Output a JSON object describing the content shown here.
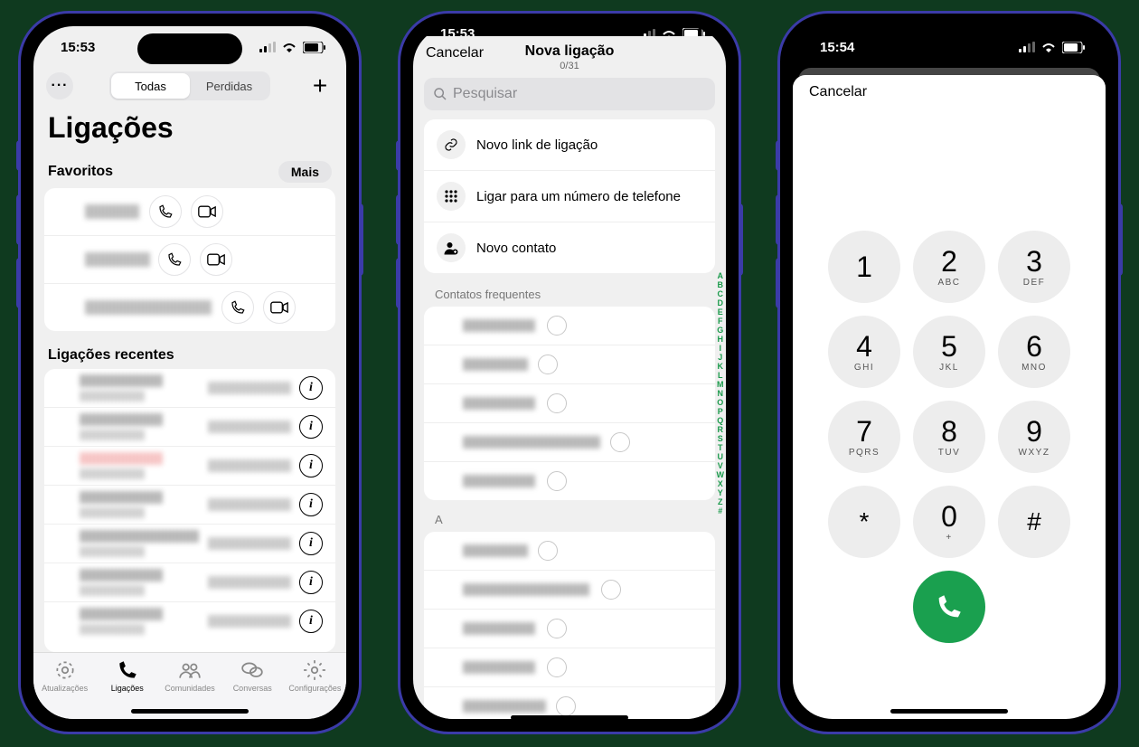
{
  "status": {
    "time1": "15:53",
    "time2": "15:53",
    "time3": "15:54"
  },
  "p1": {
    "seg_all": "Todas",
    "seg_missed": "Perdidas",
    "title": "Ligações",
    "fav_hdr": "Favoritos",
    "fav_more": "Mais",
    "recent_hdr": "Ligações recentes",
    "tabs": {
      "updates": "Atualizações",
      "calls": "Ligações",
      "communities": "Comunidades",
      "chats": "Conversas",
      "settings": "Configurações"
    }
  },
  "p2": {
    "cancel": "Cancelar",
    "title": "Nova ligação",
    "subtitle": "0/31",
    "search_placeholder": "Pesquisar",
    "opt_link": "Novo link de ligação",
    "opt_dial": "Ligar para um número de telefone",
    "opt_new_contact": "Novo contato",
    "freq_hdr": "Contatos frequentes",
    "alpha_hdr": "A",
    "index": [
      "A",
      "B",
      "C",
      "D",
      "E",
      "F",
      "G",
      "H",
      "I",
      "J",
      "K",
      "L",
      "M",
      "N",
      "O",
      "P",
      "Q",
      "R",
      "S",
      "T",
      "U",
      "V",
      "W",
      "X",
      "Y",
      "Z",
      "#"
    ]
  },
  "p3": {
    "cancel": "Cancelar",
    "keys": [
      {
        "n": "1",
        "l": ""
      },
      {
        "n": "2",
        "l": "ABC"
      },
      {
        "n": "3",
        "l": "DEF"
      },
      {
        "n": "4",
        "l": "GHI"
      },
      {
        "n": "5",
        "l": "JKL"
      },
      {
        "n": "6",
        "l": "MNO"
      },
      {
        "n": "7",
        "l": "PQRS"
      },
      {
        "n": "8",
        "l": "TUV"
      },
      {
        "n": "9",
        "l": "WXYZ"
      },
      {
        "n": "*",
        "l": ""
      },
      {
        "n": "0",
        "l": "+"
      },
      {
        "n": "#",
        "l": ""
      }
    ]
  }
}
